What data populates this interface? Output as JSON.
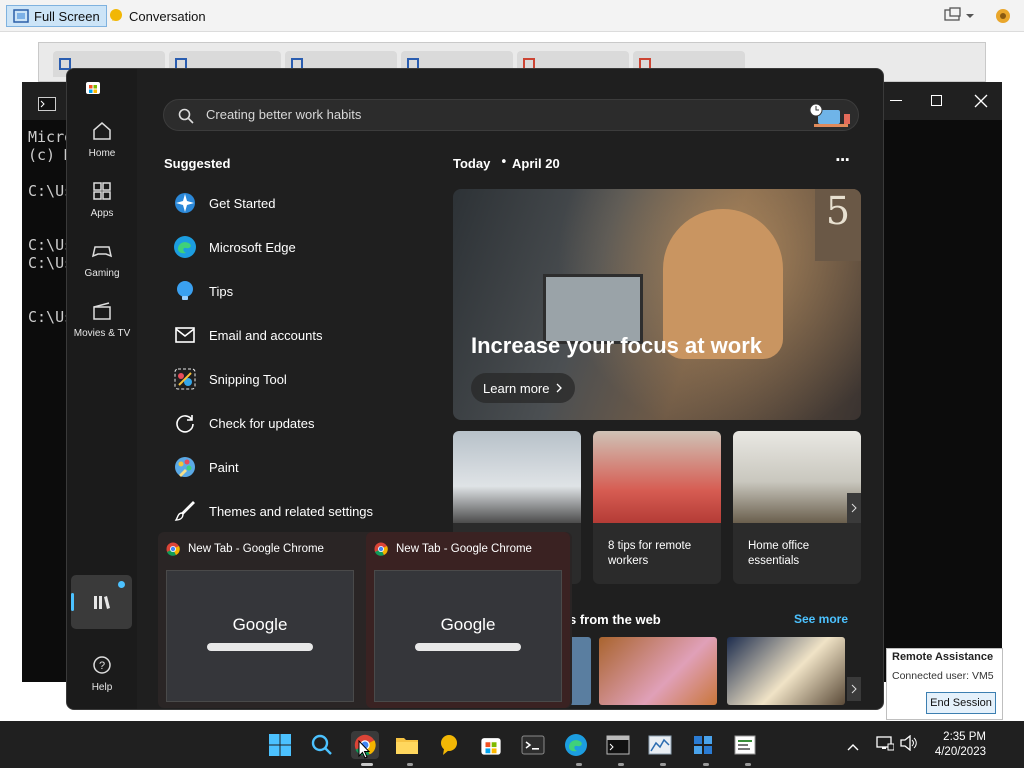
{
  "toolbar": {
    "full_screen_label": "Full Screen",
    "conversation_label": "Conversation"
  },
  "console": {
    "lines": [
      "Micro",
      "(c) M",
      "",
      "C:\\Us",
      "",
      "C:\\Us",
      "C:\\Us",
      "",
      "C:\\Us"
    ]
  },
  "start_menu": {
    "search_placeholder": "Creating better work habits",
    "rail": [
      {
        "label": "Home",
        "icon": "home-icon"
      },
      {
        "label": "Apps",
        "icon": "apps-icon"
      },
      {
        "label": "Gaming",
        "icon": "gaming-icon"
      },
      {
        "label": "Movies & TV",
        "icon": "movies-icon"
      },
      {
        "label": "Help",
        "icon": "help-icon"
      }
    ],
    "suggested_heading": "Suggested",
    "suggested": [
      {
        "label": "Get Started",
        "icon": "get-started-icon"
      },
      {
        "label": "Microsoft Edge",
        "icon": "edge-icon"
      },
      {
        "label": "Tips",
        "icon": "tips-icon"
      },
      {
        "label": "Email and accounts",
        "icon": "mail-icon"
      },
      {
        "label": "Snipping Tool",
        "icon": "snipping-tool-icon"
      },
      {
        "label": "Check for updates",
        "icon": "refresh-icon"
      },
      {
        "label": "Paint",
        "icon": "paint-icon"
      },
      {
        "label": "Themes and related settings",
        "icon": "brush-icon"
      }
    ],
    "today_label": "Today",
    "date_label": "April 20",
    "more_label": "···",
    "hero": {
      "title": "Increase your focus at work",
      "cta": "Learn more",
      "wall_number": "5"
    },
    "cards": [
      {
        "caption": ""
      },
      {
        "caption": "8 tips for remote workers"
      },
      {
        "caption": "Home office essentials"
      }
    ],
    "web_heading": "s from the web",
    "see_more": "See more"
  },
  "chrome_previews": [
    {
      "title": "New Tab - Google Chrome",
      "logo": "Google"
    },
    {
      "title": "New Tab - Google Chrome",
      "logo": "Google"
    }
  ],
  "remote_assistance": {
    "title": "Remote Assistance",
    "connected": "Connected user: VM5",
    "end_session": "End Session"
  },
  "taskbar": {
    "time": "2:35 PM",
    "date": "4/20/2023"
  }
}
